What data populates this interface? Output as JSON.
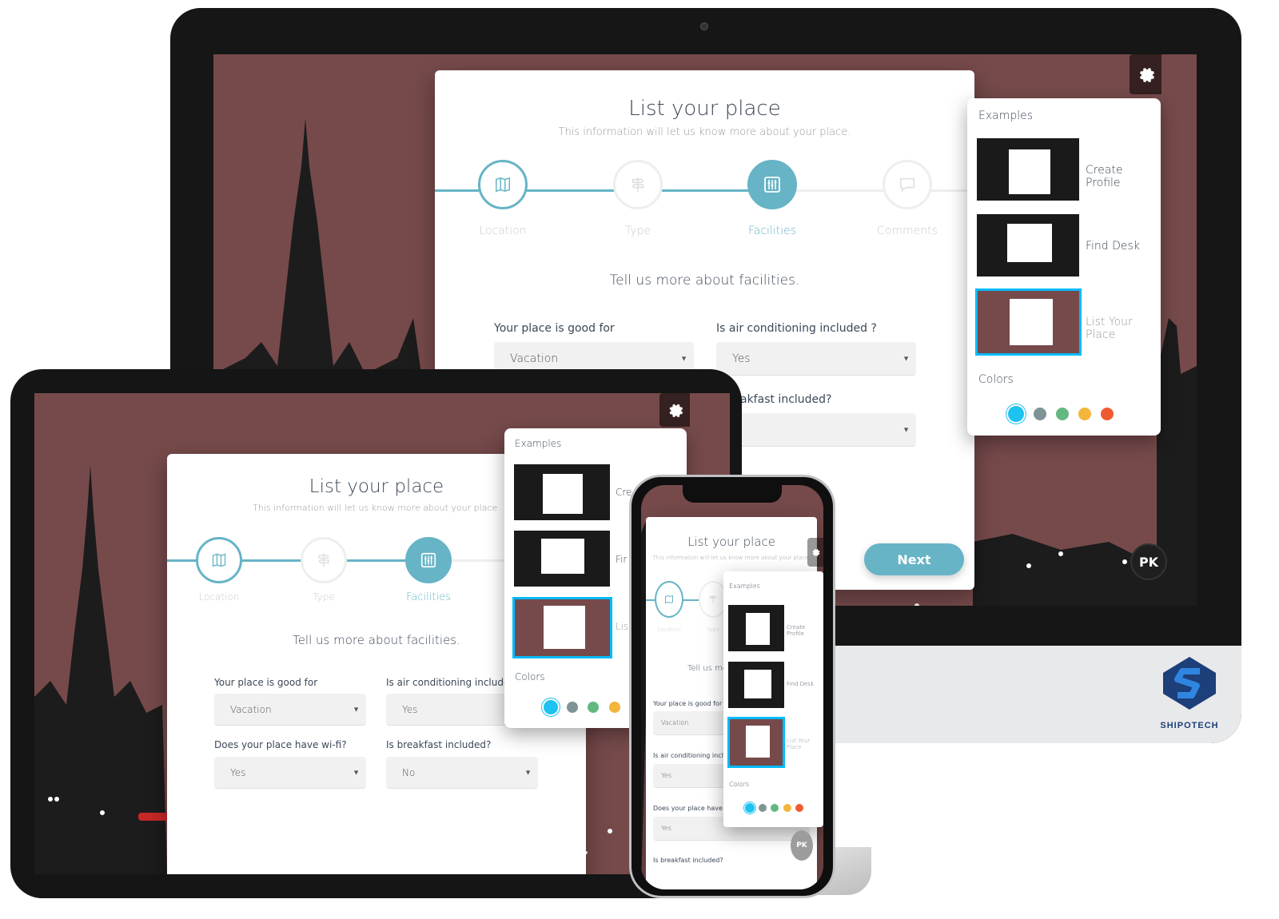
{
  "wizard": {
    "title": "List your place",
    "subtitle": "This information will let us know more about your place.",
    "steps": [
      {
        "label": "Location",
        "icon": "map-icon"
      },
      {
        "label": "Type",
        "icon": "signpost-icon"
      },
      {
        "label": "Facilities",
        "icon": "facilities-icon"
      },
      {
        "label": "Comments",
        "icon": "comments-icon"
      }
    ],
    "question": "Tell us more about facilities.",
    "fields": {
      "good_for": {
        "label": "Your place is good for",
        "value": "Vacation"
      },
      "air_conditioning": {
        "label": "Is air conditioning included ?",
        "value": "Yes"
      },
      "wifi": {
        "label": "Does your place have wi-fi?",
        "value": "Yes"
      },
      "breakfast": {
        "label": "Is breakfast included?",
        "value": "No"
      }
    },
    "next_label": "Next",
    "desktop_partial_breakfast_label": "akfast included?",
    "tablet_air_label_cut": "Is air conditioning included",
    "phone_question_cut": "Tell us mor"
  },
  "settings_panel": {
    "examples_heading": "Examples",
    "examples": [
      {
        "label": "Create Profile",
        "tablet_cut": "Cre"
      },
      {
        "label": "Find Desk",
        "tablet_cut": "Fir"
      },
      {
        "label": "List Your Place",
        "tablet_cut": "Lis"
      }
    ],
    "colors_heading": "Colors",
    "colors": [
      "#1ec2f0",
      "#7f9397",
      "#63b882",
      "#f3b53b",
      "#ee5b31"
    ]
  },
  "user": {
    "initials": "PK"
  },
  "brand": {
    "name": "SHIPOTECH"
  },
  "accent_color": "#66b4c6"
}
